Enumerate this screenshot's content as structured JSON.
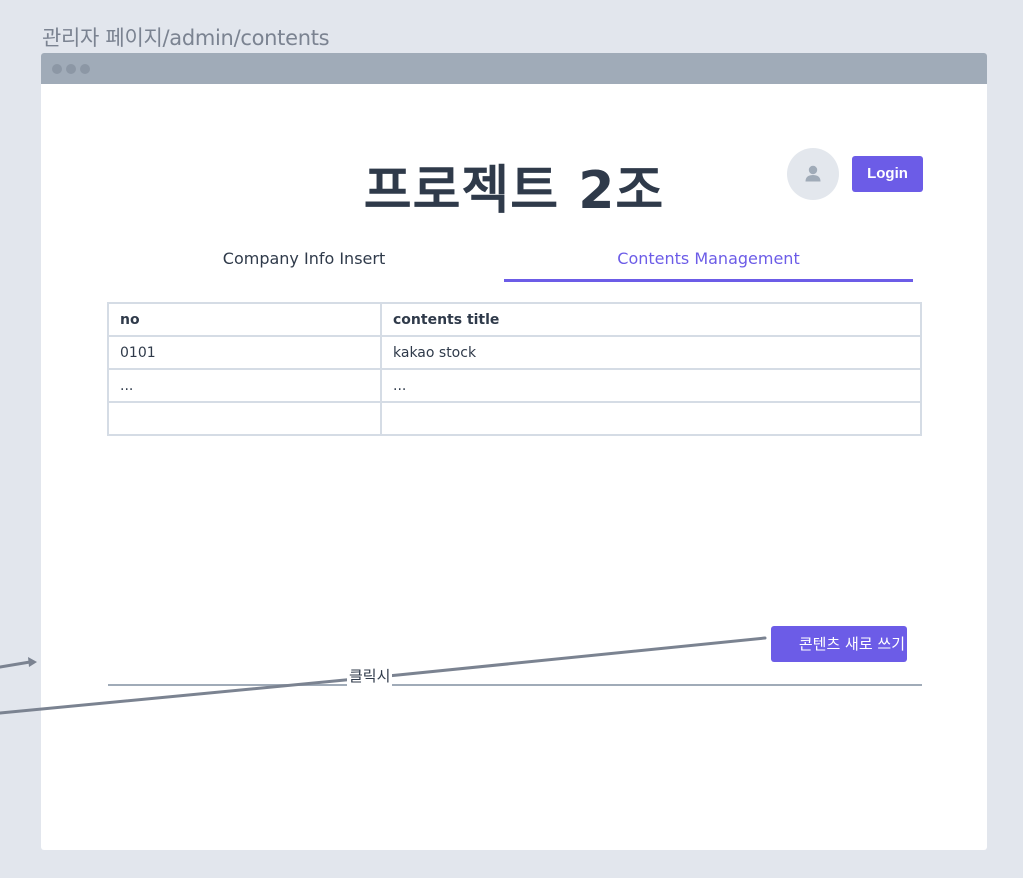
{
  "page_label": "관리자 페이지/admin/contents",
  "header": {
    "title": "프로젝트 2조",
    "login_label": "Login"
  },
  "tabs": [
    {
      "label": "Company Info Insert",
      "active": false
    },
    {
      "label": "Contents Management",
      "active": true
    }
  ],
  "table": {
    "columns": [
      "no",
      "contents title"
    ],
    "rows": [
      [
        "0101",
        "kakao stock"
      ],
      [
        "...",
        "..."
      ],
      [
        "",
        ""
      ]
    ]
  },
  "new_content_button": "콘텐츠 새로 쓰기",
  "annotation": {
    "label": "클릭시"
  },
  "colors": {
    "accent": "#6c5ce7",
    "background": "#e2e6ed",
    "text": "#2f3a4a",
    "browser_bar": "#a0abb8",
    "connector": "#7b8391"
  },
  "icons": {
    "avatar": "user-avatar-icon",
    "arrow": "arrow-right-icon"
  }
}
